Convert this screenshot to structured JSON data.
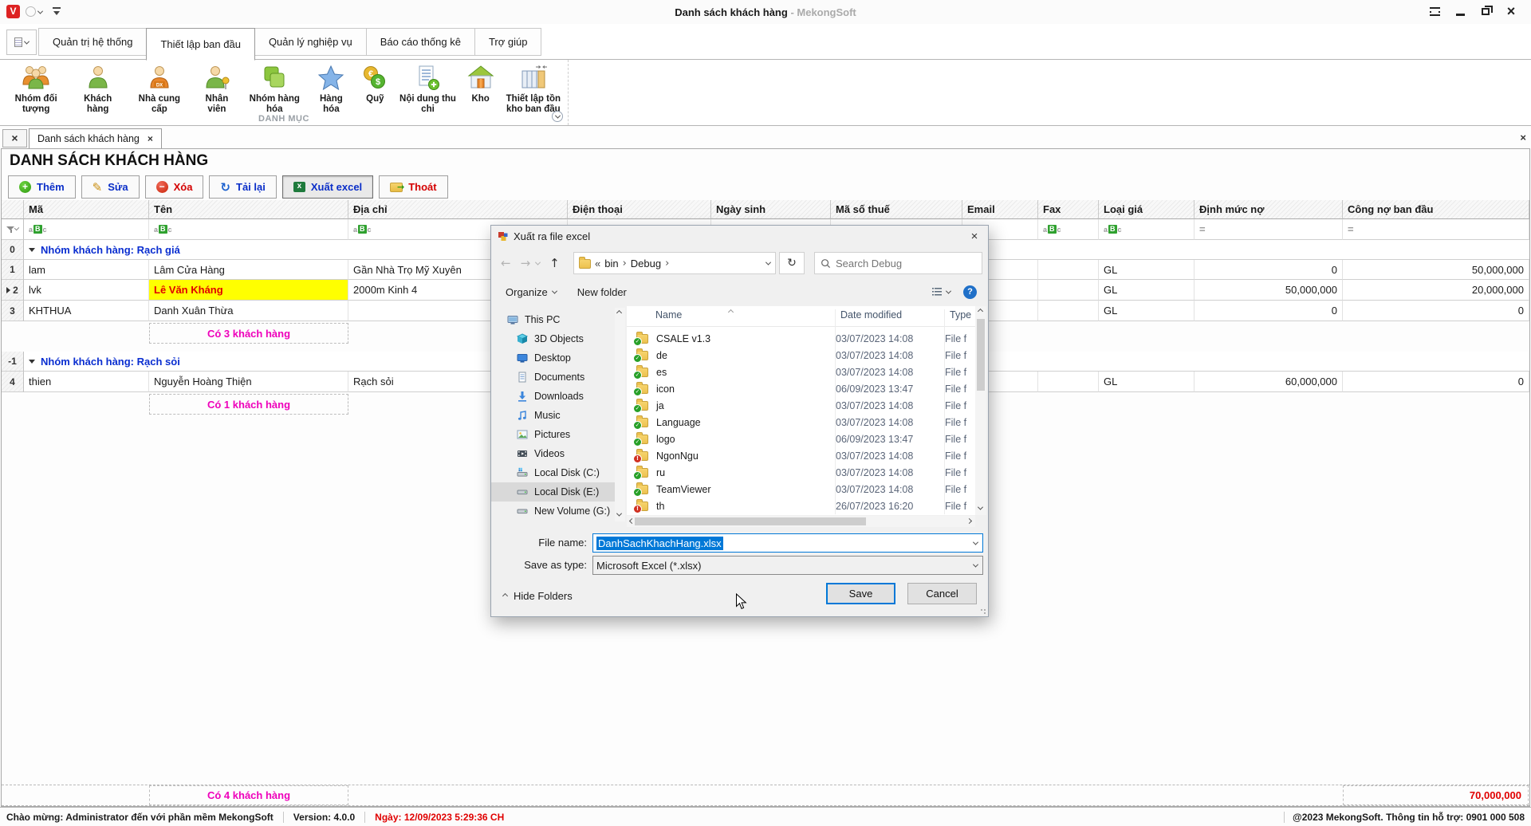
{
  "titlebar": {
    "logo_letter": "V",
    "title": "Danh sách khách hàng",
    "suffix": "- MekongSoft"
  },
  "ribbon": {
    "tabs": [
      {
        "label": "Quản trị hệ thống"
      },
      {
        "label": "Thiết lập ban đầu"
      },
      {
        "label": "Quản lý nghiệp vụ"
      },
      {
        "label": "Báo cáo thống kê"
      },
      {
        "label": "Trợ giúp"
      }
    ],
    "active_tab": "Thiết lập ban đầu",
    "group_label": "DANH MỤC",
    "items": [
      {
        "label": "Nhóm đối tượng",
        "icon": "people-group-icon"
      },
      {
        "label": "Khách hàng",
        "icon": "customer-icon"
      },
      {
        "label": "Nhà cung cấp",
        "icon": "supplier-icon"
      },
      {
        "label": "Nhân viên",
        "icon": "employee-icon"
      },
      {
        "label": "Nhóm hàng hóa",
        "icon": "product-group-icon"
      },
      {
        "label": "Hàng hóa",
        "icon": "star-icon"
      },
      {
        "label": "Quỹ",
        "icon": "coins-icon"
      },
      {
        "label": "Nội dung thu chi",
        "icon": "document-plus-icon"
      },
      {
        "label": "Kho",
        "icon": "warehouse-icon"
      },
      {
        "label": "Thiết lập tồn kho ban đầu",
        "icon": "stock-setup-icon"
      }
    ]
  },
  "tabstrip": {
    "active_tab": "Danh sách khách hàng"
  },
  "page": {
    "title": "DANH SÁCH KHÁCH HÀNG"
  },
  "toolbar": {
    "add": "Thêm",
    "edit": "Sửa",
    "delete": "Xóa",
    "reload": "Tải lại",
    "export": "Xuất excel",
    "exit": "Thoát"
  },
  "grid": {
    "columns": [
      "Mã",
      "Tên",
      "Địa chỉ",
      "Điện thoại",
      "Ngày sinh",
      "Mã số thuế",
      "Email",
      "Fax",
      "Loại giá",
      "Định mức nợ",
      "Công nợ ban đầu"
    ],
    "group1": {
      "index": "0",
      "label": "Nhóm khách hàng: Rạch giá",
      "summary": "Có 3 khách hàng"
    },
    "group2": {
      "index": "-1",
      "label": "Nhóm khách hàng: Rạch sỏi",
      "summary": "Có 1 khách hàng"
    },
    "r1": {
      "index": "1",
      "ma": "lam",
      "ten": "Lâm Cửa Hàng",
      "diachi": "Gần Nhà Trọ Mỹ Xuyên",
      "loaigia": "GL",
      "dinhmuc": "0",
      "congno": "50,000,000"
    },
    "r2": {
      "index": "2",
      "ma": "lvk",
      "ten": "Lê Văn Kháng",
      "diachi": "2000m Kinh 4",
      "loaigia": "GL",
      "dinhmuc": "50,000,000",
      "congno": "20,000,000"
    },
    "r3": {
      "index": "3",
      "ma": "KHTHUA",
      "ten": "Danh Xuân Thừa",
      "diachi": "",
      "loaigia": "GL",
      "dinhmuc": "0",
      "congno": "0"
    },
    "r4": {
      "index": "4",
      "ma": "thien",
      "ten": "Nguyễn Hoàng Thiện",
      "diachi": "Rạch sỏi",
      "loaigia": "GL",
      "dinhmuc": "60,000,000",
      "congno": "0"
    },
    "total_summary": "Có 4 khách hàng",
    "total_congno": "70,000,000"
  },
  "dialog": {
    "title": "Xuất ra file excel",
    "breadcrumb": {
      "prefix": "«",
      "part1": "bin",
      "part2": "Debug"
    },
    "search_placeholder": "Search Debug",
    "organize_label": "Organize",
    "new_folder_label": "New folder",
    "tree": [
      {
        "label": "This PC",
        "icon": "computer-icon"
      },
      {
        "label": "3D Objects",
        "icon": "cube-icon"
      },
      {
        "label": "Desktop",
        "icon": "desktop-icon"
      },
      {
        "label": "Documents",
        "icon": "document-icon"
      },
      {
        "label": "Downloads",
        "icon": "download-icon"
      },
      {
        "label": "Music",
        "icon": "music-icon"
      },
      {
        "label": "Pictures",
        "icon": "picture-icon"
      },
      {
        "label": "Videos",
        "icon": "video-icon"
      },
      {
        "label": "Local Disk (C:)",
        "icon": "disk-icon"
      },
      {
        "label": "Local Disk (E:)",
        "icon": "disk-icon",
        "selected": true
      },
      {
        "label": "New Volume (G:)",
        "icon": "disk-icon"
      }
    ],
    "list_columns": [
      "Name",
      "Date modified",
      "Type"
    ],
    "files": [
      {
        "name": "CSALE v1.3",
        "date": "03/07/2023 14:08",
        "type": "File f",
        "status": "synced"
      },
      {
        "name": "de",
        "date": "03/07/2023 14:08",
        "type": "File f",
        "status": "synced"
      },
      {
        "name": "es",
        "date": "03/07/2023 14:08",
        "type": "File f",
        "status": "synced"
      },
      {
        "name": "icon",
        "date": "06/09/2023 13:47",
        "type": "File f",
        "status": "synced"
      },
      {
        "name": "ja",
        "date": "03/07/2023 14:08",
        "type": "File f",
        "status": "synced"
      },
      {
        "name": "Language",
        "date": "03/07/2023 14:08",
        "type": "File f",
        "status": "synced"
      },
      {
        "name": "logo",
        "date": "06/09/2023 13:47",
        "type": "File f",
        "status": "synced"
      },
      {
        "name": "NgonNgu",
        "date": "03/07/2023 14:08",
        "type": "File f",
        "status": "error"
      },
      {
        "name": "ru",
        "date": "03/07/2023 14:08",
        "type": "File f",
        "status": "synced"
      },
      {
        "name": "TeamViewer",
        "date": "03/07/2023 14:08",
        "type": "File f",
        "status": "synced"
      },
      {
        "name": "th",
        "date": "26/07/2023 16:20",
        "type": "File f",
        "status": "error"
      }
    ],
    "file_name_label": "File name:",
    "file_name_value": "DanhSachKhachHang.xlsx",
    "save_as_type_label": "Save as type:",
    "save_as_type_value": "Microsoft Excel  (*.xlsx)",
    "hide_folders_label": "Hide Folders",
    "save_label": "Save",
    "cancel_label": "Cancel"
  },
  "statusbar": {
    "welcome": "Chào mừng: Administrator đến với phần mềm MekongSoft",
    "version": "Version: 4.0.0",
    "date": "Ngày: 12/09/2023 5:29:36 CH",
    "support": "@2023 MekongSoft. Thông tin hỗ trợ: 0901 000 508"
  },
  "colors": {
    "accent_blue": "#0a2ec8",
    "alert_red": "#d40000",
    "summary_pink": "#ee00bb",
    "selection_yellow": "#ffff00",
    "save_accent": "#0078d7"
  }
}
